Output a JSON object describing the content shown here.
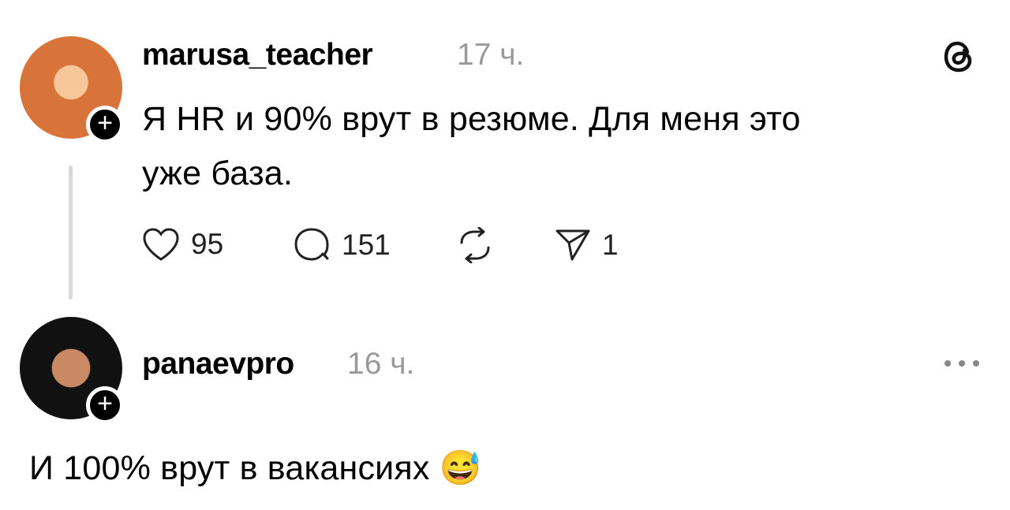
{
  "post": {
    "username": "marusa_teacher",
    "time": "17 ч.",
    "text_line1": "Я HR и 90% врут в резюме. Для меня это",
    "text_line2": "уже база.",
    "likes": "95",
    "replies": "151",
    "shares": "1"
  },
  "reply": {
    "username": "panaevpro",
    "time": "16 ч.",
    "text": "И 100% врут в вакансиях",
    "emoji": "😅"
  },
  "icons": {
    "threads": "threads-logo-icon",
    "more": "more-icon",
    "heart": "heart-icon",
    "comment": "comment-icon",
    "repost": "repost-icon",
    "send": "send-icon"
  }
}
